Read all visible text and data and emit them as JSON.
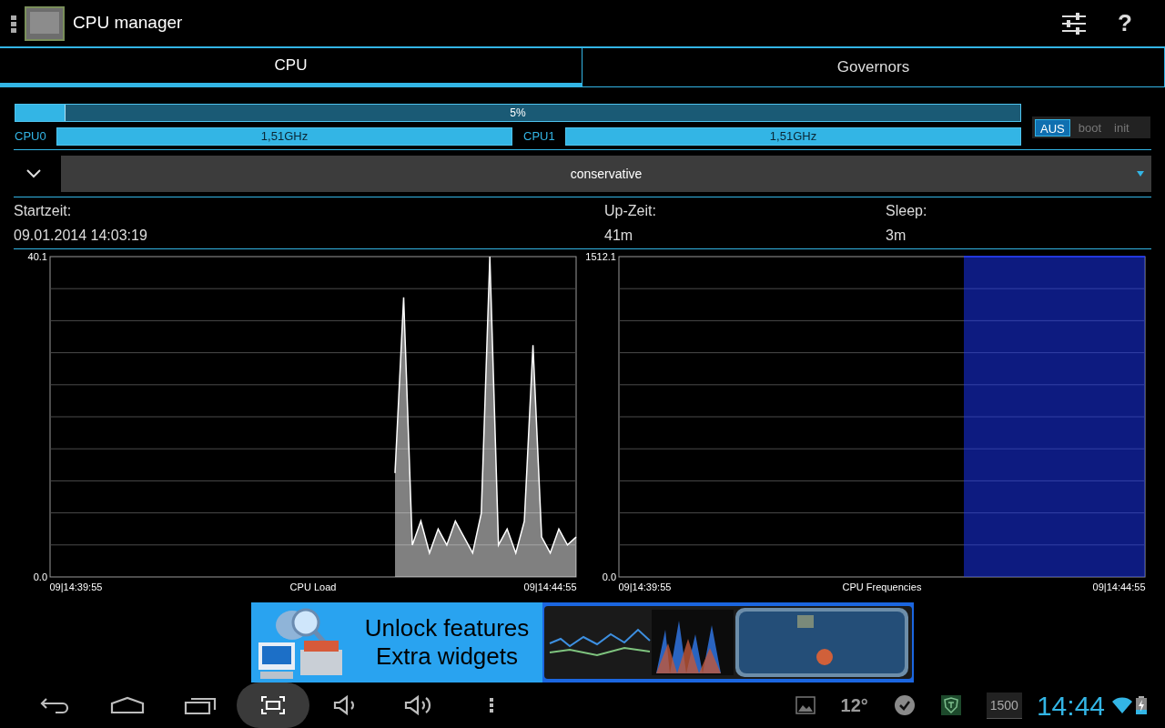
{
  "action_bar": {
    "title": "CPU manager",
    "actions": [
      {
        "kind": "settings"
      },
      {
        "kind": "help",
        "label": "?"
      }
    ]
  },
  "tabs": [
    {
      "label": "CPU",
      "selected": true
    },
    {
      "label": "Governors",
      "selected": false
    }
  ],
  "usage": {
    "level": 0.05,
    "reading": "5%"
  },
  "cores": [
    {
      "label": "CPU0",
      "level": 1,
      "reading": "1,51GHz"
    },
    {
      "label": "CPU1",
      "level": 1,
      "reading": "1,51GHz"
    }
  ],
  "apply_on": [
    {
      "label": "AUS",
      "selected": true
    },
    {
      "label": "boot",
      "selected": false
    },
    {
      "label": "init",
      "selected": false
    }
  ],
  "governor": {
    "value": "conservative",
    "expanded": false
  },
  "info": [
    {
      "label": "Startzeit:",
      "value": "09.01.2014 14:03:19"
    },
    {
      "label": "Up-Zeit:",
      "value": "41m"
    },
    {
      "label": "Sleep:",
      "value": "3m"
    }
  ],
  "charts": [
    {
      "chart_data": {
        "type": "area",
        "xlabel": "CPU Load",
        "ylim": [
          0,
          40.1
        ],
        "yticks": [
          {
            "value": 0,
            "label": "0.0"
          },
          {
            "value": 40.1,
            "label": "40.1"
          }
        ],
        "categories": [
          null,
          null,
          null,
          "09|14:39:55",
          null,
          null,
          null,
          null,
          null,
          null,
          null,
          null,
          null,
          null,
          null,
          null,
          null,
          null,
          null,
          null,
          null,
          null,
          null,
          null,
          null,
          null,
          null,
          null,
          null,
          null,
          null,
          null,
          null,
          null,
          null,
          null,
          null,
          null,
          null,
          null,
          null,
          null,
          null,
          null,
          null,
          null,
          null,
          null,
          null,
          null,
          null,
          null,
          null,
          null,
          null,
          null,
          null,
          null,
          "09|14:44:55",
          null,
          null,
          null
        ],
        "series": [
          {
            "color": "#ffffff",
            "values": [
              null,
              null,
              null,
              null,
              null,
              null,
              null,
              null,
              null,
              null,
              null,
              null,
              null,
              null,
              null,
              null,
              null,
              null,
              null,
              null,
              null,
              null,
              null,
              null,
              null,
              null,
              null,
              null,
              null,
              null,
              null,
              null,
              null,
              null,
              null,
              null,
              null,
              null,
              null,
              null,
              13,
              35,
              4,
              7,
              3,
              6,
              4,
              7,
              5,
              3,
              8,
              40.1,
              4,
              6,
              3,
              7,
              29,
              5,
              3,
              6,
              4,
              5
            ]
          }
        ]
      }
    },
    {
      "chart_data": {
        "type": "area",
        "xlabel": "CPU Frequencies",
        "ylim": [
          0,
          1512.1
        ],
        "yticks": [
          {
            "value": 0,
            "label": "0.0"
          },
          {
            "value": 1512.1,
            "label": "1512.1"
          }
        ],
        "categories": [
          null,
          null,
          null,
          "09|14:39:55",
          null,
          null,
          null,
          null,
          null,
          null,
          null,
          null,
          null,
          null,
          null,
          null,
          null,
          null,
          null,
          null,
          null,
          null,
          null,
          null,
          null,
          null,
          null,
          null,
          null,
          null,
          null,
          null,
          null,
          null,
          null,
          null,
          null,
          null,
          null,
          null,
          null,
          null,
          null,
          null,
          null,
          null,
          null,
          null,
          null,
          null,
          null,
          null,
          null,
          null,
          null,
          null,
          null,
          null,
          "09|14:44:55",
          null,
          null,
          null
        ],
        "series": [
          {
            "color": "#1a35ff",
            "values": [
              null,
              null,
              null,
              null,
              null,
              null,
              null,
              null,
              null,
              null,
              null,
              null,
              null,
              null,
              null,
              null,
              null,
              null,
              null,
              null,
              null,
              null,
              null,
              null,
              null,
              null,
              null,
              null,
              null,
              null,
              null,
              null,
              null,
              null,
              null,
              null,
              null,
              null,
              null,
              null,
              1512,
              1512,
              1512,
              1512,
              1512,
              1512,
              1512,
              1512,
              1512,
              1512,
              1512,
              1512,
              1512,
              1512,
              1512,
              1512,
              1512,
              1512,
              1512,
              1512,
              1512,
              1512
            ]
          }
        ]
      }
    }
  ],
  "ad_banner": {
    "lines": [
      "Unlock features",
      "Extra widgets"
    ]
  },
  "nav_bar": {
    "buttons": [
      {
        "kind": "back"
      },
      {
        "kind": "home"
      },
      {
        "kind": "recent"
      },
      {
        "kind": "screenshot",
        "selected": true
      },
      {
        "kind": "volume_down"
      },
      {
        "kind": "volume_up"
      },
      {
        "kind": "menu"
      }
    ],
    "status": [
      {
        "kind": "gallery"
      },
      {
        "kind": "weather",
        "label": "12°"
      },
      {
        "kind": "check"
      },
      {
        "kind": "shield"
      },
      {
        "kind": "counter",
        "label": "1500"
      }
    ],
    "time": "14:44"
  }
}
